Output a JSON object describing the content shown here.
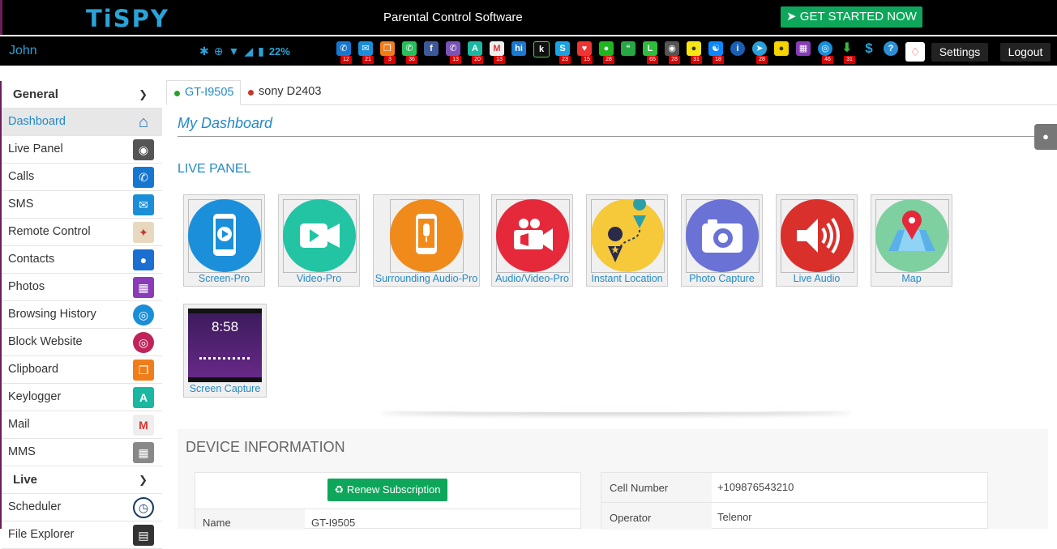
{
  "brand": {
    "logo": "TiSPY",
    "tagline": "Parental Control Software",
    "cta": "GET STARTED NOW"
  },
  "user": {
    "name": "John"
  },
  "status": {
    "battery": "22%"
  },
  "app_badges": [
    "12",
    "21",
    "3",
    "36",
    "",
    "13",
    "20",
    "13",
    "",
    "",
    "23",
    "15",
    "28",
    "",
    "65",
    "28",
    "31",
    "18",
    "",
    "28",
    "",
    "",
    "46",
    "31",
    "",
    ""
  ],
  "header_buttons": {
    "settings": "Settings",
    "logout": "Logout"
  },
  "sidebar": {
    "general_label": "General",
    "general_items": [
      {
        "label": "Dashboard",
        "icon": "home-icon"
      },
      {
        "label": "Live Panel",
        "icon": "camera-icon"
      },
      {
        "label": "Calls",
        "icon": "phone-icon"
      },
      {
        "label": "SMS",
        "icon": "envelope-icon"
      },
      {
        "label": "Remote Control",
        "icon": "remote-icon"
      },
      {
        "label": "Contacts",
        "icon": "contact-icon"
      },
      {
        "label": "Photos",
        "icon": "photo-icon"
      },
      {
        "label": "Browsing History",
        "icon": "globe-icon"
      },
      {
        "label": "Block Website",
        "icon": "block-globe-icon"
      },
      {
        "label": "Clipboard",
        "icon": "clipboard-icon"
      },
      {
        "label": "Keylogger",
        "icon": "keylogger-icon"
      },
      {
        "label": "Mail",
        "icon": "gmail-icon"
      },
      {
        "label": "MMS",
        "icon": "mms-icon"
      }
    ],
    "live_label": "Live",
    "live_items": [
      {
        "label": "Scheduler",
        "icon": "clock-icon"
      },
      {
        "label": "File Explorer",
        "icon": "folder-icon"
      }
    ]
  },
  "tabs": [
    {
      "label": "GT-I9505",
      "dot": "#2aa02a"
    },
    {
      "label": "sony D2403",
      "dot": "#c0392b"
    }
  ],
  "dashboard": {
    "title": "My Dashboard",
    "live_panel_title": "LIVE PANEL"
  },
  "tiles": [
    {
      "label": "Screen-Pro",
      "color": "#1c8fdb"
    },
    {
      "label": "Video-Pro",
      "color": "#22c4a3"
    },
    {
      "label": "Surrounding Audio-Pro",
      "color": "#f08a1a"
    },
    {
      "label": "Audio/Video-Pro",
      "color": "#e5283a"
    },
    {
      "label": "Instant Location",
      "color": "#f5c93a"
    },
    {
      "label": "Photo Capture",
      "color": "#6a72d6"
    },
    {
      "label": "Live Audio",
      "color": "#d9302c"
    },
    {
      "label": "Map",
      "color": "#7ed0a0"
    },
    {
      "label": "Screen Capture",
      "color": "#3a1a5a"
    }
  ],
  "screen_capture": {
    "time": "8:58"
  },
  "device_info": {
    "title": "DEVICE INFORMATION",
    "renew": "Renew Subscription",
    "left": [
      {
        "key": "Name",
        "value": "GT-I9505"
      }
    ],
    "right": [
      {
        "key": "Cell Number",
        "value": "+109876543210"
      },
      {
        "key": "Operator",
        "value": "Telenor"
      }
    ]
  }
}
